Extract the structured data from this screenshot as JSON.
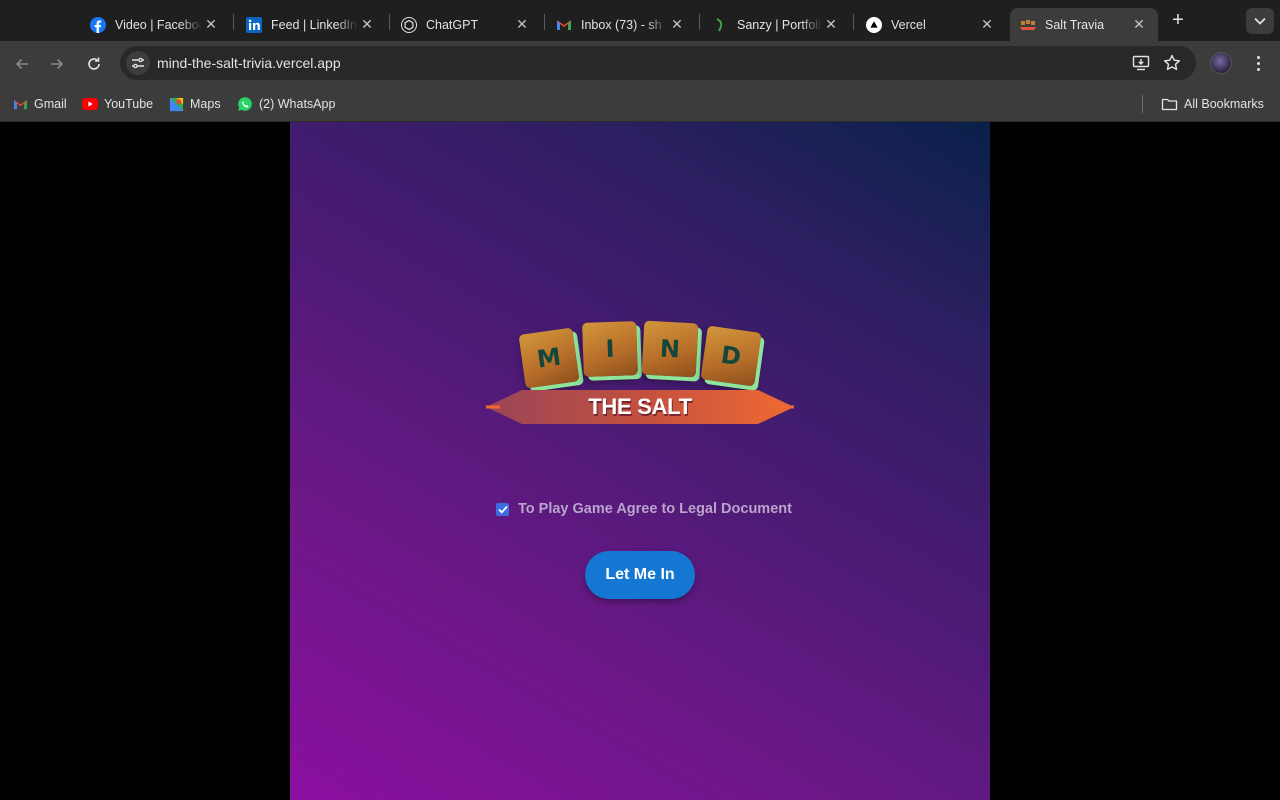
{
  "browser": {
    "tabs": [
      {
        "title": "Video | Facebook",
        "icon": "facebook-icon"
      },
      {
        "title": "Feed | LinkedIn",
        "icon": "linkedin-icon"
      },
      {
        "title": "ChatGPT",
        "icon": "chatgpt-icon"
      },
      {
        "title": "Inbox (73) - sh",
        "icon": "gmail-icon"
      },
      {
        "title": "Sanzy | Portfolio",
        "icon": "portfolio-icon"
      },
      {
        "title": "Vercel",
        "icon": "vercel-icon"
      },
      {
        "title": "Salt Travia",
        "icon": "salt-travia-icon",
        "active": true
      }
    ],
    "address": "mind-the-salt-trivia.vercel.app",
    "bookmarks": [
      {
        "label": "Gmail",
        "icon": "gmail-icon"
      },
      {
        "label": "YouTube",
        "icon": "youtube-icon"
      },
      {
        "label": "Maps",
        "icon": "maps-icon"
      },
      {
        "label": "(2) WhatsApp",
        "icon": "whatsapp-icon"
      }
    ],
    "all_bookmarks_label": "All Bookmarks"
  },
  "app": {
    "logo": {
      "letters": [
        "M",
        "I",
        "N",
        "D"
      ],
      "banner": "THE SALT",
      "tile_color": "#c0802f",
      "tile_shadow_color": "#8ee49a",
      "letter_color": "#14463a",
      "banner_color": "#e2553a"
    },
    "agreement": {
      "label": "To Play Game Agree to Legal Document",
      "checked": true
    },
    "button_label": "Let Me In",
    "button_color": "#1478d2",
    "background_colors": [
      "#8b0fa0",
      "#4e1a76",
      "#09204a"
    ]
  }
}
